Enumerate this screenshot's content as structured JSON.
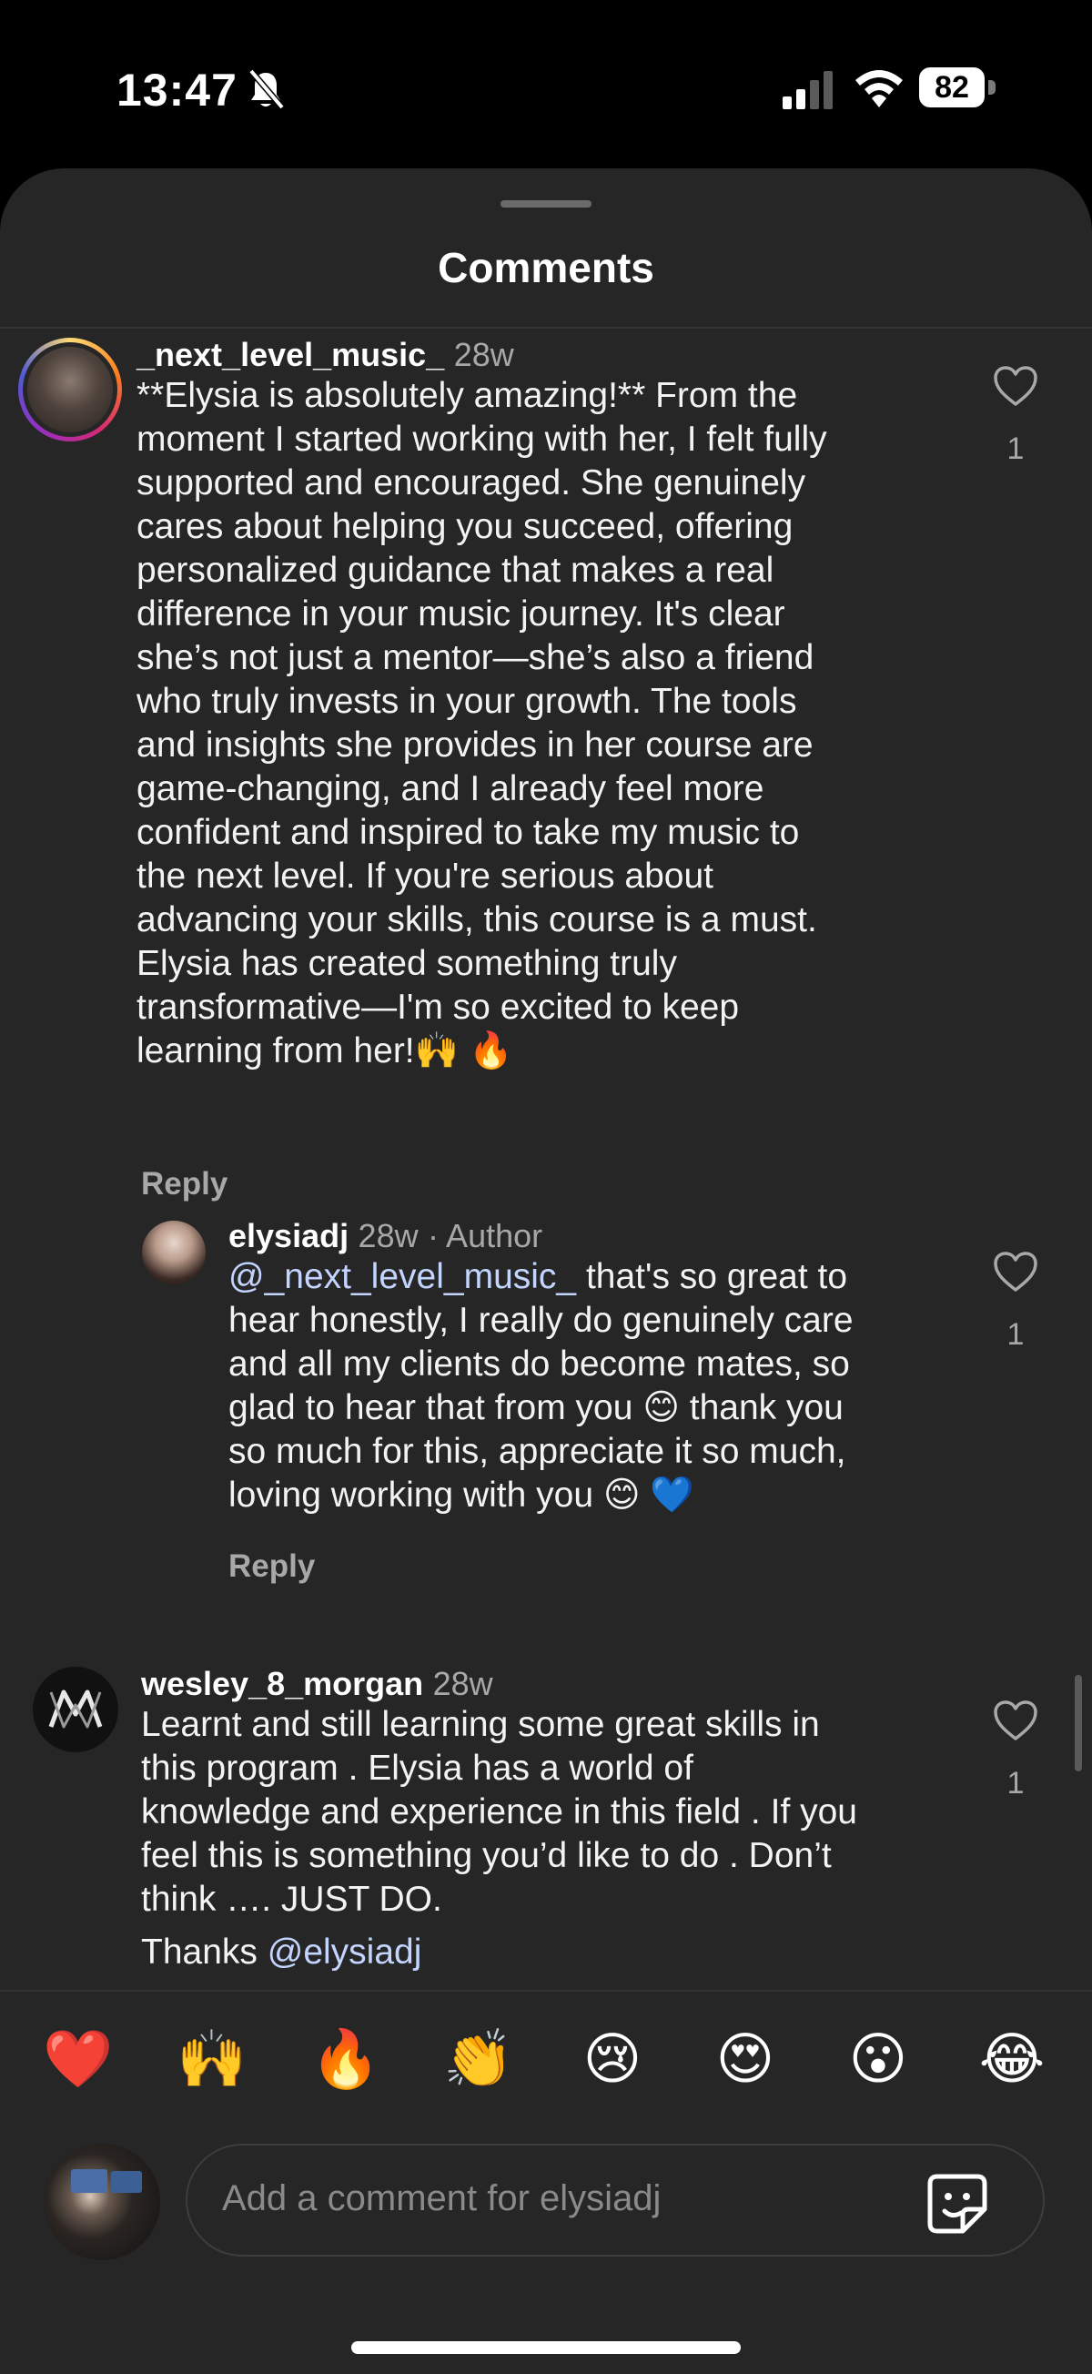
{
  "status_bar": {
    "time": "13:47",
    "battery": "82"
  },
  "header": {
    "title": "Comments"
  },
  "comments": [
    {
      "username": "_next_level_music_",
      "time": "28w",
      "text_lines": [
        "**Elysia is absolutely amazing!** From the",
        "moment I started working with her, I felt fully",
        "supported and encouraged. She genuinely",
        "cares about helping you succeed, offering",
        "personalized guidance that makes a real",
        "difference in your music journey. It's clear",
        "she’s not just a mentor—she’s also a friend",
        "who truly invests in your growth. The tools",
        "and insights she provides in her course are",
        "game-changing, and I already feel more",
        "confident and inspired to take my music to",
        "the next level. If you're serious about",
        "advancing your skills, this course is a must.",
        "Elysia has created something truly",
        "transformative—I'm so excited to keep",
        "learning from her!🙌 🔥"
      ],
      "reply_label": "Reply",
      "likes": "1"
    },
    {
      "username": "elysiadj",
      "time": "28w",
      "badge": "· Author",
      "mention": "@_next_level_music_",
      "text_first_rest": " that's so great to",
      "text_lines": [
        "hear honestly, I really do genuinely care",
        "and all my clients do become mates, so",
        "glad to hear that from you 😊 thank you",
        "so much for this, appreciate it so much,",
        "loving working with you 😊 💙"
      ],
      "reply_label": "Reply",
      "likes": "1"
    },
    {
      "username": "wesley_8_morgan",
      "time": "28w",
      "text_lines": [
        "Learnt and still learning some great skills in",
        "this program . Elysia has a world of",
        "knowledge and experience in this field . If you",
        "feel this is something you’d like to do . Don’t",
        "think …. JUST DO."
      ],
      "thanks_text": "Thanks ",
      "thanks_mention": "@elysiadj",
      "likes": "1"
    }
  ],
  "emoji_bar": [
    "❤️",
    "🙌",
    "🔥",
    "👏",
    "😢",
    "😍",
    "😮",
    "😂"
  ],
  "composer": {
    "placeholder": "Add a comment for elysiadj"
  },
  "colors": {
    "sheet": "#262626",
    "mention": "#c3d5ff",
    "meta": "#a8a8a8"
  }
}
